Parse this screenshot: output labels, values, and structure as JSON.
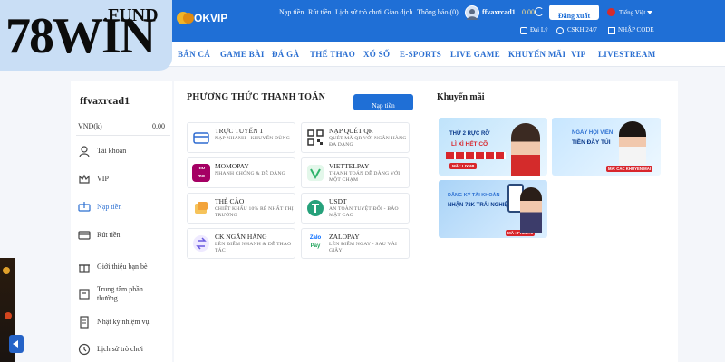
{
  "brand": {
    "logo_main": "78WIN",
    "logo_suffix": ".FUND",
    "partner": "OKVIP"
  },
  "topbar": {
    "links": [
      "Nạp tiền",
      "Rút tiền",
      "Lịch sử trò chơi",
      "Giao dịch",
      "Thông báo (0)"
    ],
    "username": "ffvaxrcad1",
    "balance": "0.00",
    "logout_label": "Đăng xuất",
    "language": "Tiếng Việt",
    "sub_links": [
      "Đại Lý",
      "CSKH 24/7",
      "NHẬP CODE"
    ]
  },
  "nav": {
    "items": [
      "BẮN CÁ",
      "GAME BÀI",
      "ĐÁ GÀ",
      "THỂ THAO",
      "XỔ SỐ",
      "E-SPORTS",
      "LIVE GAME",
      "KHUYẾN MÃI",
      "VIP",
      "LIVESTREAM"
    ]
  },
  "sidebar": {
    "username": "ffvaxrcad1",
    "currency": "VND(k)",
    "balance": "0.00",
    "items": [
      {
        "label": "Tài khoản",
        "icon": "user-icon"
      },
      {
        "label": "VIP",
        "icon": "crown-icon"
      },
      {
        "label": "Nạp tiền",
        "icon": "deposit-icon"
      },
      {
        "label": "Rút tiền",
        "icon": "withdraw-icon"
      },
      {
        "label": "Giới thiệu bạn bè",
        "icon": "gift-icon"
      },
      {
        "label": "Trung tâm phần thưởng",
        "icon": "reward-icon"
      },
      {
        "label": "Nhật ký nhiệm vụ",
        "icon": "task-icon"
      },
      {
        "label": "Lịch sử trò chơi",
        "icon": "history-icon"
      }
    ]
  },
  "payment": {
    "title": "PHƯƠNG THỨC THANH TOÁN",
    "deposit_button": "Nạp tiền",
    "methods": [
      {
        "title": "TRỰC TUYẾN 1",
        "desc": "NẠP NHANH - KHUYẾN DÙNG",
        "icon": "card-icon",
        "color": "#2e6bd1"
      },
      {
        "title": "NẠP QUÉT QR",
        "desc": "QUÉT MÃ QR VỚI NGÂN HÀNG ĐA DẠNG",
        "icon": "qr-icon",
        "color": "#333333"
      },
      {
        "title": "MOMOPAY",
        "desc": "NHANH CHÓNG & DỄ DÀNG",
        "icon": "momo-icon",
        "color": "#a50064"
      },
      {
        "title": "VIETTELPAY",
        "desc": "THANH TOÁN DỄ DÀNG VỚI MỘT CHẠM",
        "icon": "viettelpay-icon",
        "color": "#2fb36b"
      },
      {
        "title": "THẺ CÀO",
        "desc": "CHIẾT KHẤU 10% RẺ NHẤT THỊ TRƯỜNG",
        "icon": "scratch-card-icon",
        "color": "#f2a33a"
      },
      {
        "title": "USDT",
        "desc": "AN TOÀN TUYỆT ĐỐI - BẢO MẬT CAO",
        "icon": "usdt-icon",
        "color": "#26a17b"
      },
      {
        "title": "CK NGÂN HÀNG",
        "desc": "LÊN ĐIỂM NHANH & DỄ THAO TÁC",
        "icon": "bank-transfer-icon",
        "color": "#6a5be0"
      },
      {
        "title": "ZALOPAY",
        "desc": "LÊN ĐIỂM NGAY - SAU VÀI GIÂY",
        "icon": "zalopay-icon",
        "color": "#1fa45a"
      }
    ]
  },
  "promotions": {
    "title": "Khuyến mãi",
    "banners": [
      {
        "headline": "THỨ 2 RỰC RỠ",
        "sub": "LÌ XÌ HẾT CỠ",
        "code": "MÃ : LIXI68",
        "colors": [
          "#bfe3fb",
          "#e9f6ff"
        ]
      },
      {
        "headline": "NGÀY HỘI VIÊN",
        "sub": "TIỀN ĐẦY TÚI",
        "code": "MÃ: CÁC KHUYẾN MÃI",
        "colors": [
          "#c7e6ff",
          "#eef8ff"
        ]
      },
      {
        "headline": "ĐĂNG KÝ TÀI KHOẢN",
        "sub": "NHẬN 78K TRẢI NGHIỆM",
        "code": "MÃ : FREE78",
        "colors": [
          "#a9d3f7",
          "#dcefff"
        ]
      }
    ]
  },
  "colors": {
    "primary": "#1f6fd6",
    "nav_text": "#2b6fd1",
    "logo_bg": "#c9def5"
  }
}
